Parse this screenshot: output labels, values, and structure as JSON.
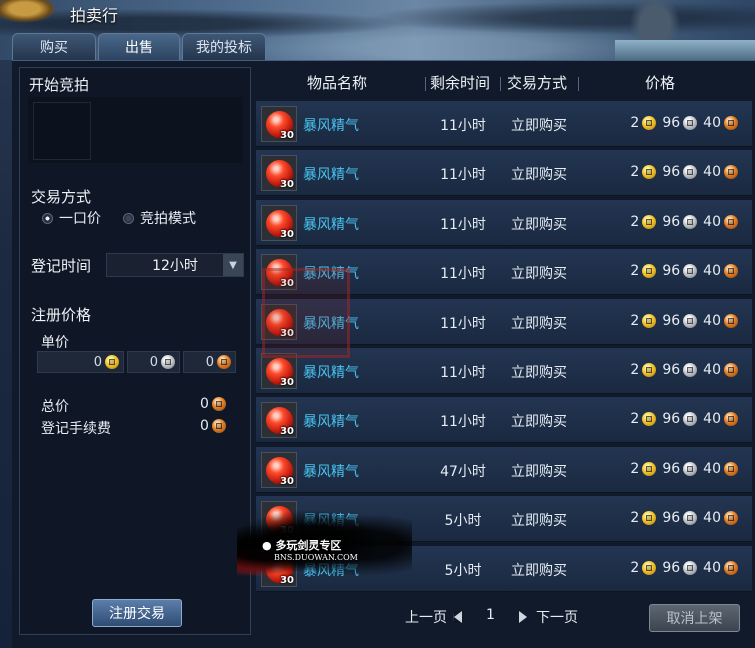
{
  "window": {
    "title": "拍卖行"
  },
  "tabs": [
    {
      "label": "购买"
    },
    {
      "label": "出售"
    },
    {
      "label": "我的投标"
    }
  ],
  "left_panel": {
    "section_auction": "开始竞拍",
    "section_method": "交易方式",
    "method_options": [
      {
        "label": "一口价",
        "selected": true
      },
      {
        "label": "竞拍模式",
        "selected": false
      }
    ],
    "duration_label": "登记时间",
    "duration_value": "12小时",
    "section_price": "注册价格",
    "unit_price_label": "单价",
    "unit_price": {
      "gold": "0",
      "silver": "0",
      "copper": "0"
    },
    "total_label": "总价",
    "total_value": "0",
    "fee_label": "登记手续费",
    "fee_value": "0",
    "register_button": "注册交易"
  },
  "table": {
    "headers": {
      "name": "物品名称",
      "time": "剩余时间",
      "method": "交易方式",
      "price": "价格"
    },
    "rows": [
      {
        "qty": "30",
        "name": "暴风精气",
        "time": "11小时",
        "method": "立即购买",
        "gold": "2",
        "silver": "96",
        "copper": "40"
      },
      {
        "qty": "30",
        "name": "暴风精气",
        "time": "11小时",
        "method": "立即购买",
        "gold": "2",
        "silver": "96",
        "copper": "40"
      },
      {
        "qty": "30",
        "name": "暴风精气",
        "time": "11小时",
        "method": "立即购买",
        "gold": "2",
        "silver": "96",
        "copper": "40"
      },
      {
        "qty": "30",
        "name": "暴风精气",
        "time": "11小时",
        "method": "立即购买",
        "gold": "2",
        "silver": "96",
        "copper": "40"
      },
      {
        "qty": "30",
        "name": "暴风精气",
        "time": "11小时",
        "method": "立即购买",
        "gold": "2",
        "silver": "96",
        "copper": "40"
      },
      {
        "qty": "30",
        "name": "暴风精气",
        "time": "11小时",
        "method": "立即购买",
        "gold": "2",
        "silver": "96",
        "copper": "40"
      },
      {
        "qty": "30",
        "name": "暴风精气",
        "time": "11小时",
        "method": "立即购买",
        "gold": "2",
        "silver": "96",
        "copper": "40"
      },
      {
        "qty": "30",
        "name": "暴风精气",
        "time": "47小时",
        "method": "立即购买",
        "gold": "2",
        "silver": "96",
        "copper": "40"
      },
      {
        "qty": "30",
        "name": "暴风精气",
        "time": "5小时",
        "method": "立即购买",
        "gold": "2",
        "silver": "96",
        "copper": "40"
      },
      {
        "qty": "30",
        "name": "暴风精气",
        "time": "5小时",
        "method": "立即购买",
        "gold": "2",
        "silver": "96",
        "copper": "40"
      }
    ]
  },
  "pager": {
    "prev": "上一页",
    "page": "1",
    "next": "下一页"
  },
  "cancel_button": "取消上架",
  "watermark": {
    "text": "多玩剑灵专区",
    "url": "BNS.DUOWAN.COM"
  },
  "colors": {
    "item_name": "#47c4f0",
    "accent_blue": "#2f4c74"
  },
  "icons": {
    "gold": "gold-coin-icon",
    "silver": "silver-coin-icon",
    "copper": "copper-coin-icon",
    "item": "storm-essence-orb-icon",
    "dropdown": "chevron-down-icon"
  }
}
